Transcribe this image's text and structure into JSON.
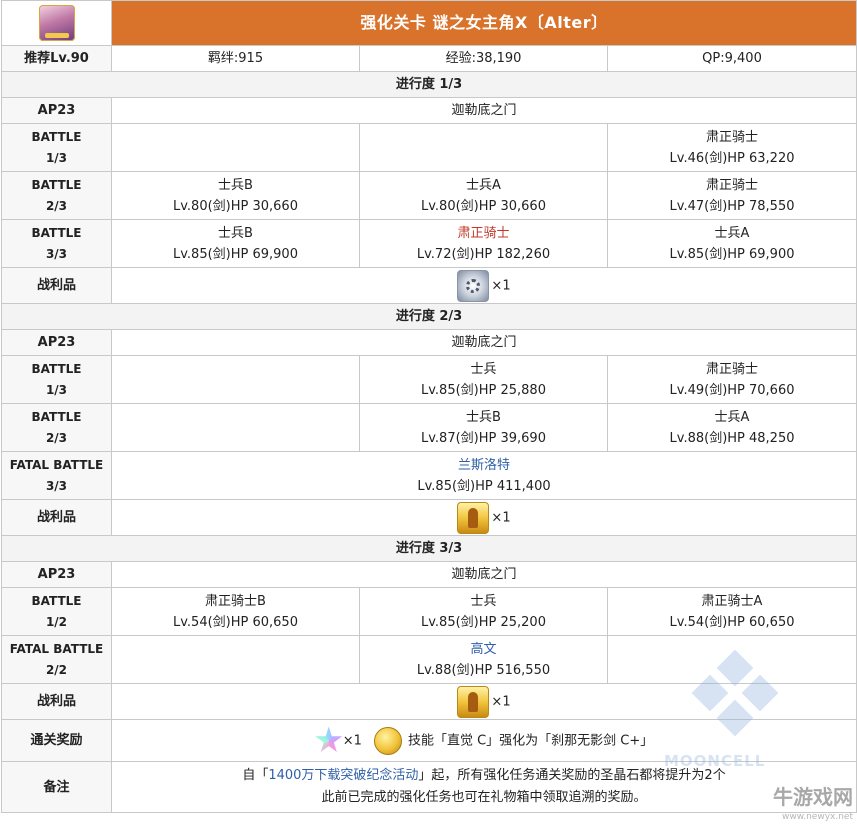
{
  "header": {
    "title": "强化关卡 谜之女主角X〔Alter〕",
    "recommend": "推荐Lv.90",
    "bond": "羁绊:915",
    "exp": "经验:38,190",
    "qp": "QP:9,400"
  },
  "sections": [
    {
      "progress": "进行度 1/3",
      "ap": "AP23",
      "location": "迦勒底之门",
      "battles": [
        {
          "label1": "BATTLE",
          "label2": "1/3",
          "enemies": [
            {
              "name": "",
              "stats": ""
            },
            {
              "name": "",
              "stats": ""
            },
            {
              "name": "肃正骑士",
              "stats": "Lv.46(剑)HP 63,220"
            }
          ]
        },
        {
          "label1": "BATTLE",
          "label2": "2/3",
          "enemies": [
            {
              "name": "士兵B",
              "stats": "Lv.80(剑)HP 30,660"
            },
            {
              "name": "士兵A",
              "stats": "Lv.80(剑)HP 30,660"
            },
            {
              "name": "肃正骑士",
              "stats": "Lv.47(剑)HP 78,550"
            }
          ]
        },
        {
          "label1": "BATTLE",
          "label2": "3/3",
          "enemies": [
            {
              "name": "士兵B",
              "stats": "Lv.85(剑)HP 69,900"
            },
            {
              "name": "肃正骑士",
              "stats": "Lv.72(剑)HP 182,260"
            },
            {
              "name": "士兵A",
              "stats": "Lv.85(剑)HP 69,900"
            }
          ]
        }
      ],
      "loot_label": "战利品",
      "loot_icon": "gear-item-icon",
      "loot_qty": "×1"
    },
    {
      "progress": "进行度 2/3",
      "ap": "AP23",
      "location": "迦勒底之门",
      "battles": [
        {
          "label1": "BATTLE",
          "label2": "1/3",
          "enemies": [
            {
              "name": "",
              "stats": ""
            },
            {
              "name": "士兵",
              "stats": "Lv.85(剑)HP 25,880"
            },
            {
              "name": "肃正骑士",
              "stats": "Lv.49(剑)HP 70,660"
            }
          ]
        },
        {
          "label1": "BATTLE",
          "label2": "2/3",
          "enemies": [
            {
              "name": "",
              "stats": ""
            },
            {
              "name": "士兵B",
              "stats": "Lv.87(剑)HP 39,690"
            },
            {
              "name": "士兵A",
              "stats": "Lv.88(剑)HP 48,250"
            }
          ]
        },
        {
          "label1": "FATAL BATTLE",
          "label2": "3/3",
          "boss": {
            "name": "兰斯洛特",
            "stats": "Lv.85(剑)HP 411,400"
          }
        }
      ],
      "loot_label": "战利品",
      "loot_icon": "statue-item-icon",
      "loot_qty": "×1"
    },
    {
      "progress": "进行度 3/3",
      "ap": "AP23",
      "location": "迦勒底之门",
      "battles": [
        {
          "label1": "BATTLE",
          "label2": "1/2",
          "enemies": [
            {
              "name": "肃正骑士B",
              "stats": "Lv.54(剑)HP 60,650"
            },
            {
              "name": "士兵",
              "stats": "Lv.85(剑)HP 25,200"
            },
            {
              "name": "肃正骑士A",
              "stats": "Lv.54(剑)HP 60,650"
            }
          ]
        },
        {
          "label1": "FATAL BATTLE",
          "label2": "2/2",
          "boss": {
            "name": "高文",
            "stats": "Lv.88(剑)HP 516,550"
          }
        }
      ],
      "loot_label": "战利品",
      "loot_icon": "statue-item-icon",
      "loot_qty": "×1"
    }
  ],
  "clear_reward": {
    "label": "通关奖励",
    "star_qty": "×1",
    "text": "技能「直觉 C」强化为「刹那无影剑 C+」"
  },
  "notes": {
    "label": "备注",
    "line1_prefix": "自「",
    "line1_link": "1400万下载突破纪念活动",
    "line1_suffix": "」起，所有强化任务通关奖励的圣晶石都将提升为2个",
    "line2": "此前已完成的强化任务也可在礼物箱中领取追溯的奖励。"
  },
  "watermark": {
    "text": "MOONCELL",
    "site_name": "牛游戏网",
    "site_url": "www.newyx.net"
  },
  "colors": {
    "header_bg": "#d9722a",
    "boss_red": "#c0392b",
    "boss_blue": "#2f5fa8"
  }
}
